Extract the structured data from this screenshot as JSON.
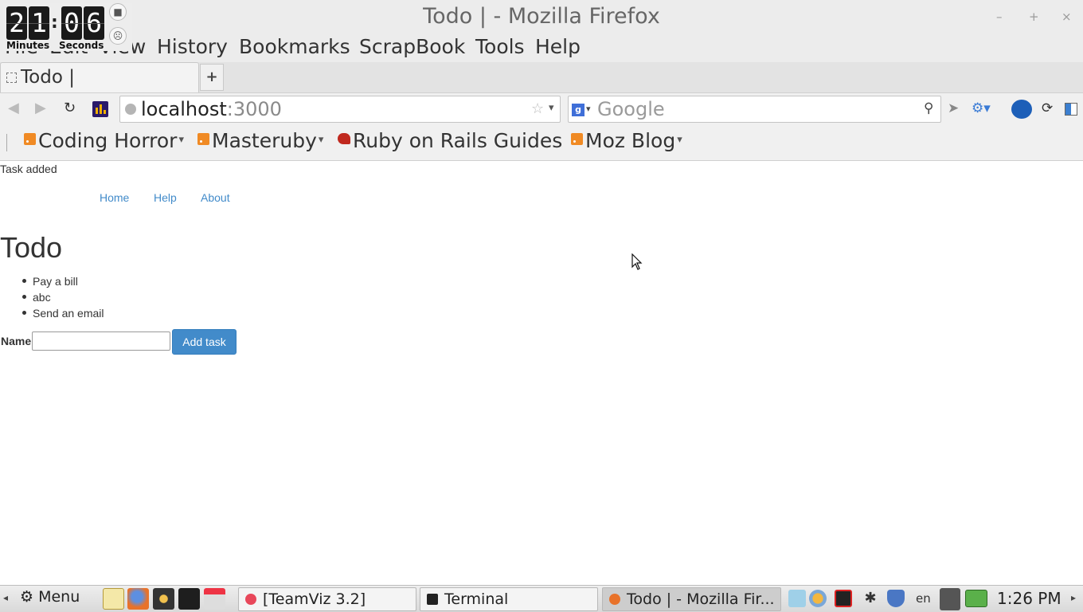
{
  "window": {
    "title": "Todo | - Mozilla Firefox",
    "controls": {
      "minimize": "–",
      "maximize": "+",
      "close": "×"
    }
  },
  "clock_widget": {
    "minutes": [
      "2",
      "1"
    ],
    "seconds": [
      "0",
      "6"
    ],
    "separator": ":",
    "minutes_label": "Minutes",
    "seconds_label": "Seconds",
    "buttons": {
      "stop": "■",
      "face": "☹"
    }
  },
  "menubar": {
    "items": [
      {
        "label": "File"
      },
      {
        "label": "Edit"
      },
      {
        "label": "View"
      },
      {
        "label": "History"
      },
      {
        "label": "Bookmarks"
      },
      {
        "label": "ScrapBook"
      },
      {
        "label": "Tools"
      },
      {
        "label": "Help"
      }
    ]
  },
  "tabs": {
    "items": [
      {
        "title": "Todo |"
      }
    ],
    "new_tab": "+"
  },
  "navbar": {
    "back": "◀",
    "forward": "▶",
    "reload": "↻",
    "url_host": "localhost",
    "url_port": ":3000",
    "star": "☆",
    "url_dropdown": "▾",
    "search_engine": "g",
    "search_engine_dropdown": "▾",
    "search_placeholder": "Google",
    "search_go": "⚲",
    "send": "➤",
    "network": "⚙▾",
    "sync": "⟳",
    "colors": {
      "stats_addon": "#2a1a6a",
      "search_engine": "#3f6fd8"
    }
  },
  "bookmarks": {
    "items": [
      {
        "label": "Coding Horror",
        "icon": "rss-icon",
        "dropdown": "▾"
      },
      {
        "label": "Masteruby",
        "icon": "rss-icon",
        "dropdown": "▾"
      },
      {
        "label": "Ruby on Rails Guides",
        "icon": "rails-icon",
        "dropdown": ""
      },
      {
        "label": "Moz Blog",
        "icon": "rss-icon",
        "dropdown": "▾"
      }
    ]
  },
  "page": {
    "flash": "Task added",
    "nav": [
      {
        "label": "Home"
      },
      {
        "label": "Help"
      },
      {
        "label": "About"
      }
    ],
    "heading": "Todo",
    "tasks": [
      {
        "name": "Pay a bill"
      },
      {
        "name": "abc"
      },
      {
        "name": "Send an email"
      }
    ],
    "form": {
      "name_label": "Name",
      "name_value": "",
      "submit_label": "Add task"
    },
    "colors": {
      "link": "#428bca",
      "button": "#428bca"
    }
  },
  "taskbar": {
    "scroll_left": "◂",
    "scroll_right": "▸",
    "menu_label": "Menu",
    "menu_icon": "⚙",
    "tasks": [
      {
        "label": "[TeamViz 3.2]",
        "active": false
      },
      {
        "label": "Terminal",
        "active": false
      },
      {
        "label": "Todo | - Mozilla Fir...",
        "active": true
      }
    ],
    "language": "en",
    "bluetooth": "✱",
    "clock": "1:26 PM"
  }
}
